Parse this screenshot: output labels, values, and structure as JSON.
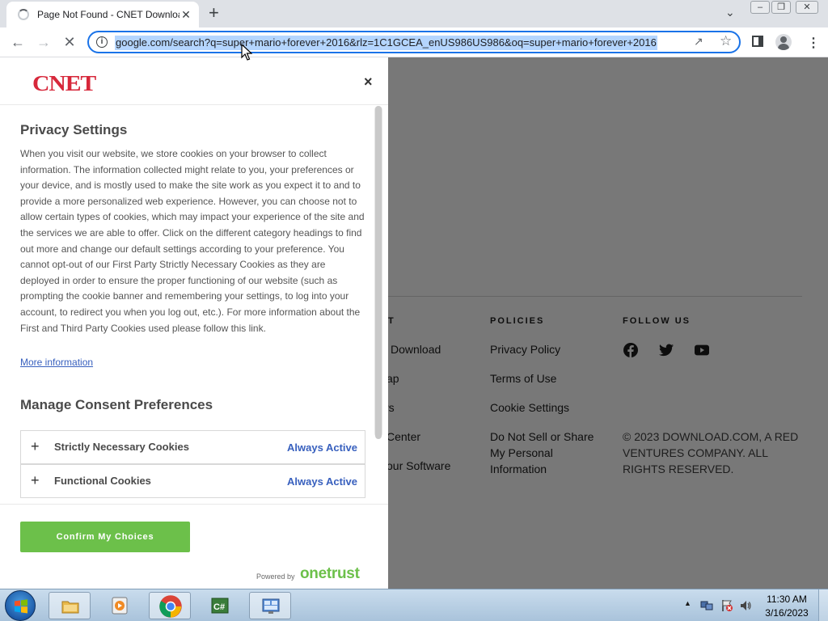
{
  "browser": {
    "tab_title": "Page Not Found - CNET Download",
    "tab_close": "✕",
    "new_tab": "+",
    "url": "google.com/search?q=super+mario+forever+2016&rlz=1C1GCEA_enUS986US986&oq=super+mario+forever+2016",
    "info_icon": "i",
    "window_controls": [
      "–",
      "❐",
      "✕"
    ]
  },
  "page_footer": {
    "columns": [
      {
        "heading": "UT",
        "links": [
          "Download",
          "ap",
          "rs",
          "Center",
          "our Software"
        ]
      },
      {
        "heading": "POLICIES",
        "links": [
          "Privacy Policy",
          "Terms of Use",
          "Cookie Settings",
          "Do Not Sell or Share My Personal Information"
        ]
      },
      {
        "heading": "FOLLOW US",
        "links": []
      }
    ],
    "social_icons": [
      "facebook-icon",
      "twitter-icon",
      "youtube-icon"
    ],
    "copyright": "© 2023 DOWNLOAD.COM, A RED VENTURES COMPANY. ALL RIGHTS RESERVED."
  },
  "consent": {
    "logo": "CNET",
    "close": "×",
    "privacy_title": "Privacy Settings",
    "privacy_body": "When you visit our website, we store cookies on your browser to collect information. The information collected might relate to you, your preferences or your device, and is mostly used to make the site work as you expect it to and to provide a more personalized web experience. However, you can choose not to allow certain types of cookies, which may impact your experience of the site and the services we are able to offer. Click on the different category headings to find out more and change our default settings according to your preference. You cannot opt-out of our First Party Strictly Necessary Cookies as they are deployed in order to ensure the proper functioning of our website (such as prompting the cookie banner and remembering your settings, to log into your account, to redirect you when you log out, etc.). For more information about the First and Third Party Cookies used please follow this link.",
    "more_info": "More information",
    "manage_title": "Manage Consent Preferences",
    "categories": [
      {
        "label": "Strictly Necessary Cookies",
        "status": "Always Active"
      },
      {
        "label": "Functional Cookies",
        "status": "Always Active"
      }
    ],
    "expand_symbol": "+",
    "confirm_label": "Confirm My Choices",
    "powered_by": "Powered by",
    "onetrust": "onetrust"
  },
  "taskbar": {
    "time": "11:30 AM",
    "date": "3/16/2023",
    "tray_arrow": "▲"
  },
  "colors": {
    "cnet_red": "#d7283b",
    "onetrust_green": "#6cc04a",
    "link_blue": "#3860be",
    "omnibox_focus": "#1a73e8"
  }
}
